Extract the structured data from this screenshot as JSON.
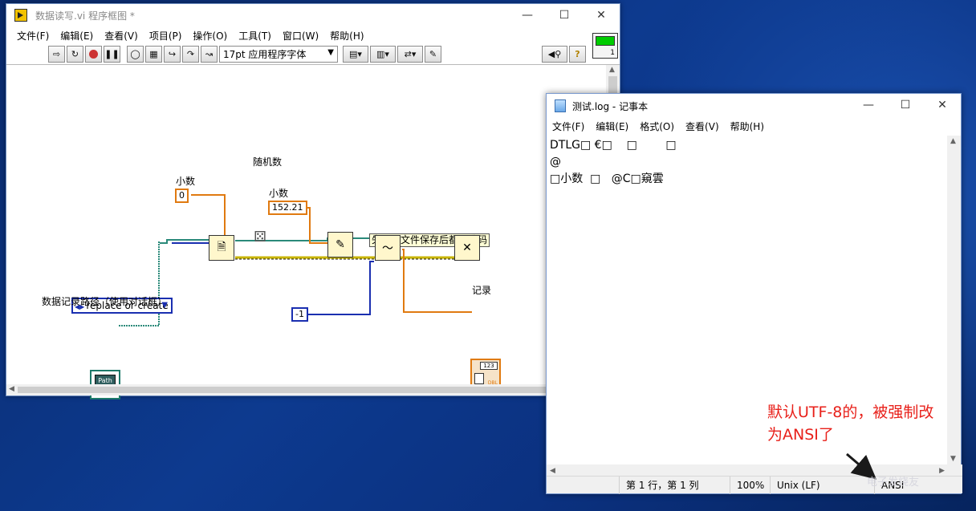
{
  "labview": {
    "title": "数据读写.vi 程序框图 *",
    "menu": [
      "文件(F)",
      "编辑(E)",
      "查看(V)",
      "项目(P)",
      "操作(O)",
      "工具(T)",
      "窗口(W)",
      "帮助(H)"
    ],
    "toolbar": {
      "font": "17pt 应用程序字体"
    },
    "vi_icon_number": "1",
    "diagram": {
      "label_decimal_1": "小数",
      "const_zero": "0",
      "label_random": "随机数",
      "label_decimal_2": "小数",
      "const_decimal": "152.21",
      "note": "失败，文件保存后都是乱码",
      "enum_value": "replace or create",
      "path_label": "数据记录路径（使用对话框）",
      "path_text": "Path",
      "const_minus_one": "-1",
      "record_label": "记录",
      "record_badge": "123",
      "record_type": "DBL"
    }
  },
  "notepad": {
    "title": "测试.log - 记事本",
    "menu": [
      "文件(F)",
      "编辑(E)",
      "格式(O)",
      "查看(V)",
      "帮助(H)"
    ],
    "content_lines": [
      "DTLG□ €□    □        □",
      "@",
      "□小数  □   @C□窺雲"
    ],
    "status": {
      "position": "第 1 行，第 1 列",
      "zoom": "100%",
      "line_ending": "Unix (LF)",
      "encoding": "ANSI"
    }
  },
  "annotation": {
    "line1": "默认UTF-8的，被强制改",
    "line2": "为ANSI了"
  },
  "watermark": "电子发烧友"
}
